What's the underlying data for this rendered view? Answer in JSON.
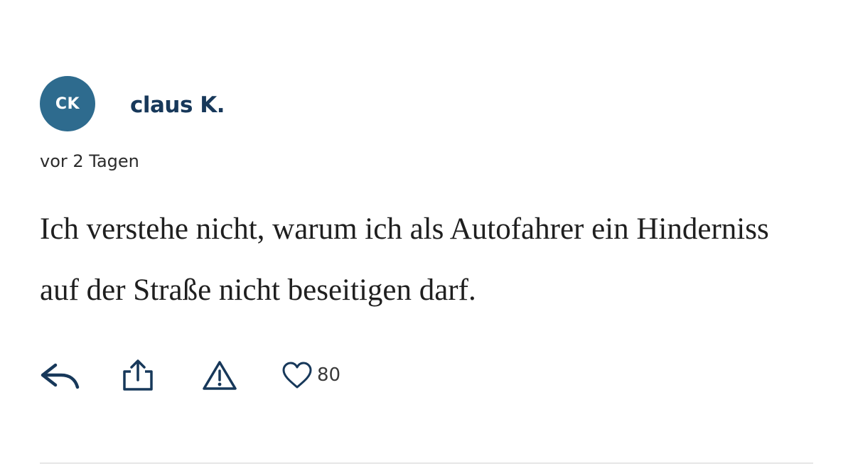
{
  "comment": {
    "avatar_initials": "CK",
    "author": "claus K.",
    "timestamp": "vor 2 Tagen",
    "text": "Ich verstehe nicht, warum ich als Autofahrer ein Hinderniss auf der Straße nicht beseitigen darf.",
    "likes": "80"
  },
  "actions": {
    "reply_icon": "reply-icon",
    "share_icon": "share-icon",
    "report_icon": "warning-icon",
    "like_icon": "heart-icon"
  },
  "colors": {
    "avatar_bg": "#2e6b8e",
    "author": "#17385a",
    "icon": "#17385a"
  }
}
